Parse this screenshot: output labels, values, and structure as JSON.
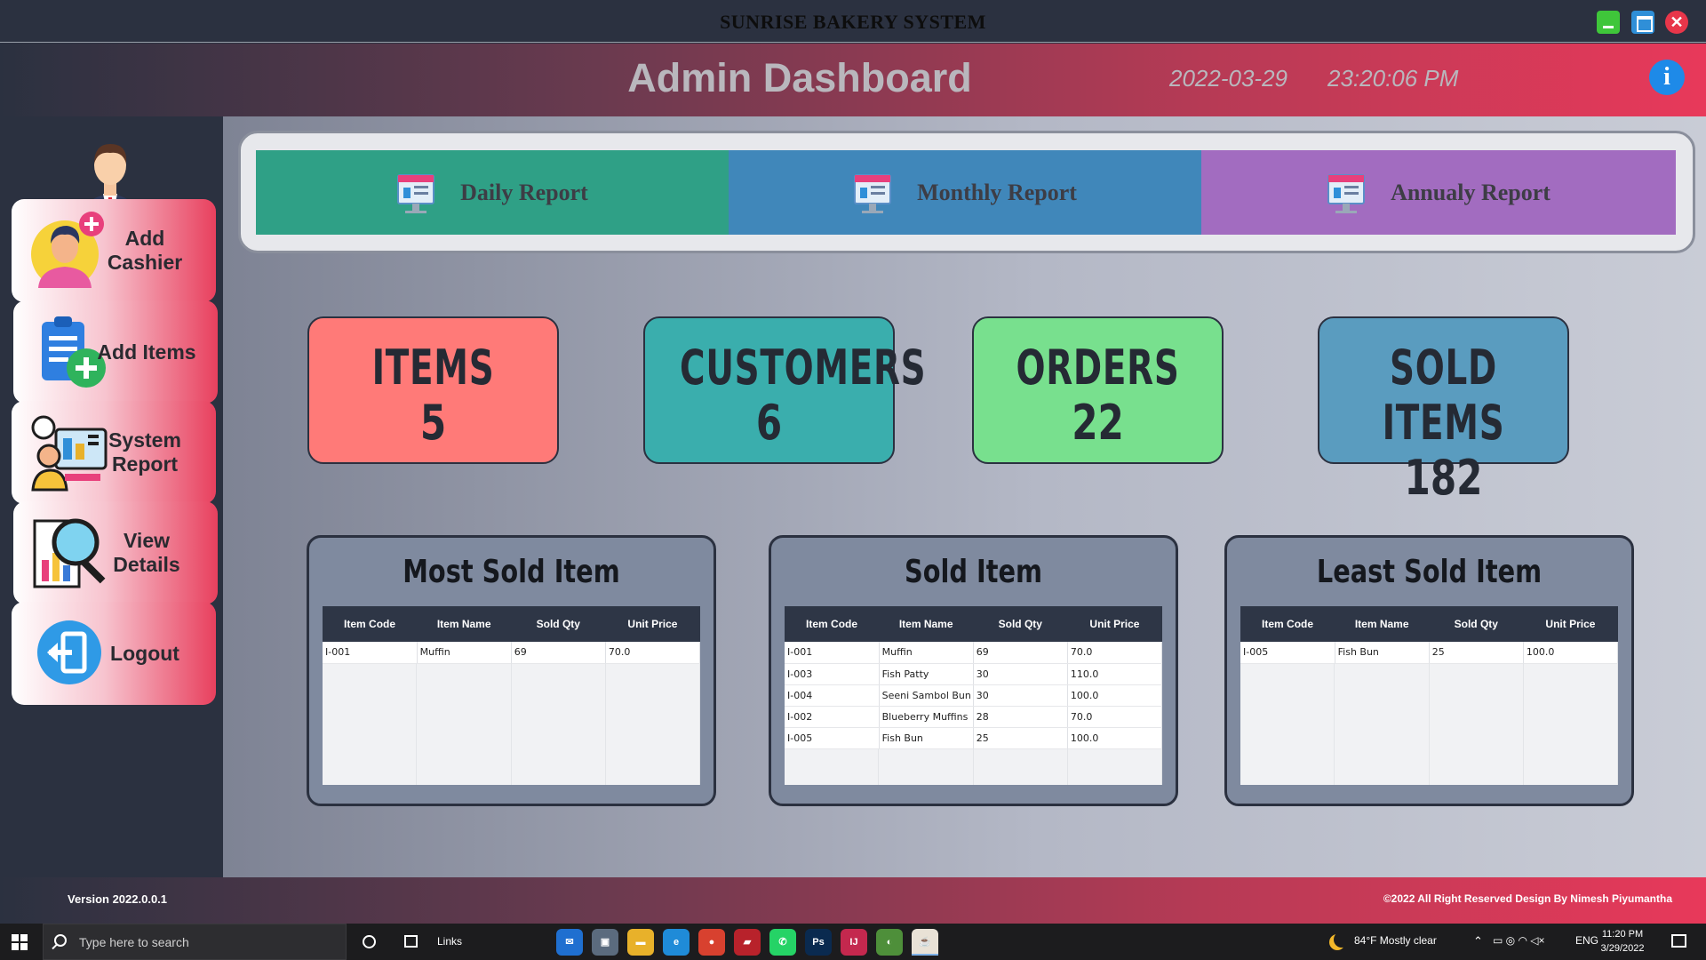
{
  "window": {
    "title": "SUNRISE BAKERY SYSTEM",
    "controls": [
      "minimize-icon",
      "maximize-icon",
      "close-icon"
    ],
    "close_glyph": "✕"
  },
  "header": {
    "title": "Admin Dashboard",
    "date": "2022-03-29",
    "time": "23:20:06 PM",
    "info_glyph": "i"
  },
  "sidebar": {
    "avatar": "admin-avatar-icon",
    "items": [
      {
        "label": "Add Cashier",
        "icon": "add-cashier-icon"
      },
      {
        "label": "Add Items",
        "icon": "add-items-icon"
      },
      {
        "label": "System Report",
        "icon": "system-report-icon"
      },
      {
        "label": "View Details",
        "icon": "view-details-icon"
      },
      {
        "label": "Logout",
        "icon": "logout-icon"
      }
    ]
  },
  "reports": [
    {
      "label": "Daily Report",
      "icon": "report-icon",
      "color": "#2fa086"
    },
    {
      "label": "Monthly Report",
      "icon": "report-icon",
      "color": "#4087ba"
    },
    {
      "label": "Annualy Report",
      "icon": "report-icon",
      "color": "#a26cc0"
    }
  ],
  "stats": [
    {
      "label": "ITEMS",
      "value": "5",
      "color": "#ff7a78"
    },
    {
      "label": "CUSTOMERS",
      "value": "6",
      "color": "#3aaead"
    },
    {
      "label": "ORDERS",
      "value": "22",
      "color": "#78e08e"
    },
    {
      "label": "SOLD ITEMS",
      "value": "182",
      "color": "#5a9cbf"
    }
  ],
  "tables": {
    "columns": [
      "Item Code",
      "Item Name",
      "Sold Qty",
      "Unit Price"
    ],
    "most_sold": {
      "title": "Most Sold Item",
      "rows": [
        [
          "I-001",
          "Muffin",
          "69",
          "70.0"
        ]
      ]
    },
    "sold": {
      "title": "Sold Item",
      "rows": [
        [
          "I-001",
          "Muffin",
          "69",
          "70.0"
        ],
        [
          "I-003",
          "Fish Patty",
          "30",
          "110.0"
        ],
        [
          "I-004",
          "Seeni Sambol Bun",
          "30",
          "100.0"
        ],
        [
          "I-002",
          "Blueberry Muffins",
          "28",
          "70.0"
        ],
        [
          "I-005",
          "Fish Bun",
          "25",
          "100.0"
        ]
      ]
    },
    "least_sold": {
      "title": "Least Sold Item",
      "rows": [
        [
          "I-005",
          "Fish Bun",
          "25",
          "100.0"
        ]
      ]
    }
  },
  "footer": {
    "version": "Version 2022.0.0.1",
    "copyright": "©2022  All Right Reserved Design By Nimesh Piyumantha"
  },
  "taskbar": {
    "search_placeholder": "Type here to search",
    "links_label": "Links",
    "apps": [
      {
        "name": "mail-icon",
        "color": "#1f6fd0",
        "glyph": "✉"
      },
      {
        "name": "photos-icon",
        "color": "#5b6b7e",
        "glyph": "▣"
      },
      {
        "name": "file-explorer-icon",
        "color": "#e8b12a",
        "glyph": "▬"
      },
      {
        "name": "edge-icon",
        "color": "#1f8bd8",
        "glyph": "e"
      },
      {
        "name": "chrome-icon",
        "color": "#d8412f",
        "glyph": "●"
      },
      {
        "name": "app-red-icon",
        "color": "#b8222b",
        "glyph": "▰"
      },
      {
        "name": "whatsapp-icon",
        "color": "#25d366",
        "glyph": "✆"
      },
      {
        "name": "photoshop-icon",
        "color": "#0a2a4f",
        "glyph": "Ps"
      },
      {
        "name": "intellij-icon",
        "color": "#c4284e",
        "glyph": "IJ"
      },
      {
        "name": "app-green-icon",
        "color": "#4e8f3a",
        "glyph": "◐"
      },
      {
        "name": "java-icon",
        "color": "#e9e2d6",
        "glyph": "☕"
      }
    ],
    "weather": "84°F  Mostly clear",
    "language": "ENG",
    "clock_time": "11:20 PM",
    "clock_date": "3/29/2022"
  }
}
